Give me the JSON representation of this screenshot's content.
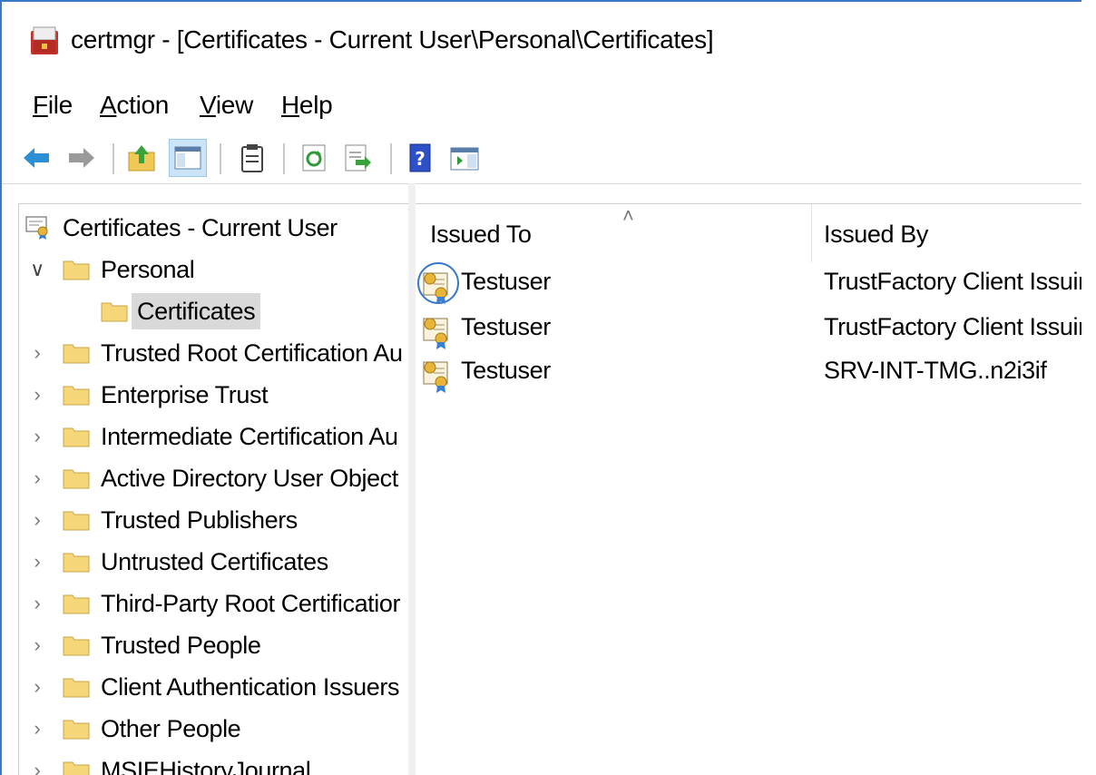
{
  "window": {
    "title": "certmgr - [Certificates - Current User\\Personal\\Certificates]"
  },
  "menu": {
    "file": {
      "acc": "F",
      "rest": "ile"
    },
    "action": {
      "acc": "A",
      "rest": "ction"
    },
    "view": {
      "acc": "V",
      "rest": "iew"
    },
    "help": {
      "acc": "H",
      "rest": "elp"
    }
  },
  "toolbar": {
    "icons": [
      "back-arrow-icon",
      "forward-arrow-icon",
      "up-folder-icon",
      "show-hide-console-tree-icon",
      "properties-icon",
      "refresh-icon",
      "export-list-icon",
      "help-icon",
      "action-pane-icon"
    ]
  },
  "tree": {
    "root": "Certificates - Current User",
    "personal": "Personal",
    "certificates": "Certificates",
    "stores": [
      "Trusted Root Certification Au",
      "Enterprise Trust",
      "Intermediate Certification Au",
      "Active Directory User Object",
      "Trusted Publishers",
      "Untrusted Certificates",
      "Third-Party Root Certificatior",
      "Trusted People",
      "Client Authentication Issuers",
      "Other People",
      "MSIEHistoryJournal"
    ]
  },
  "list": {
    "columns": {
      "issued_to": "Issued To",
      "issued_by": "Issued By"
    },
    "rows": [
      {
        "issued_to": "Testuser",
        "issued_by": "TrustFactory Client Issuin"
      },
      {
        "issued_to": "Testuser",
        "issued_by": "TrustFactory Client Issuin"
      },
      {
        "issued_to": "Testuser",
        "issued_by": "SRV-INT-TMG..n2i3if"
      }
    ]
  },
  "colors": {
    "accent": "#3a78c8",
    "folder": "#f5d77a",
    "selection": "#d9d9d9"
  }
}
